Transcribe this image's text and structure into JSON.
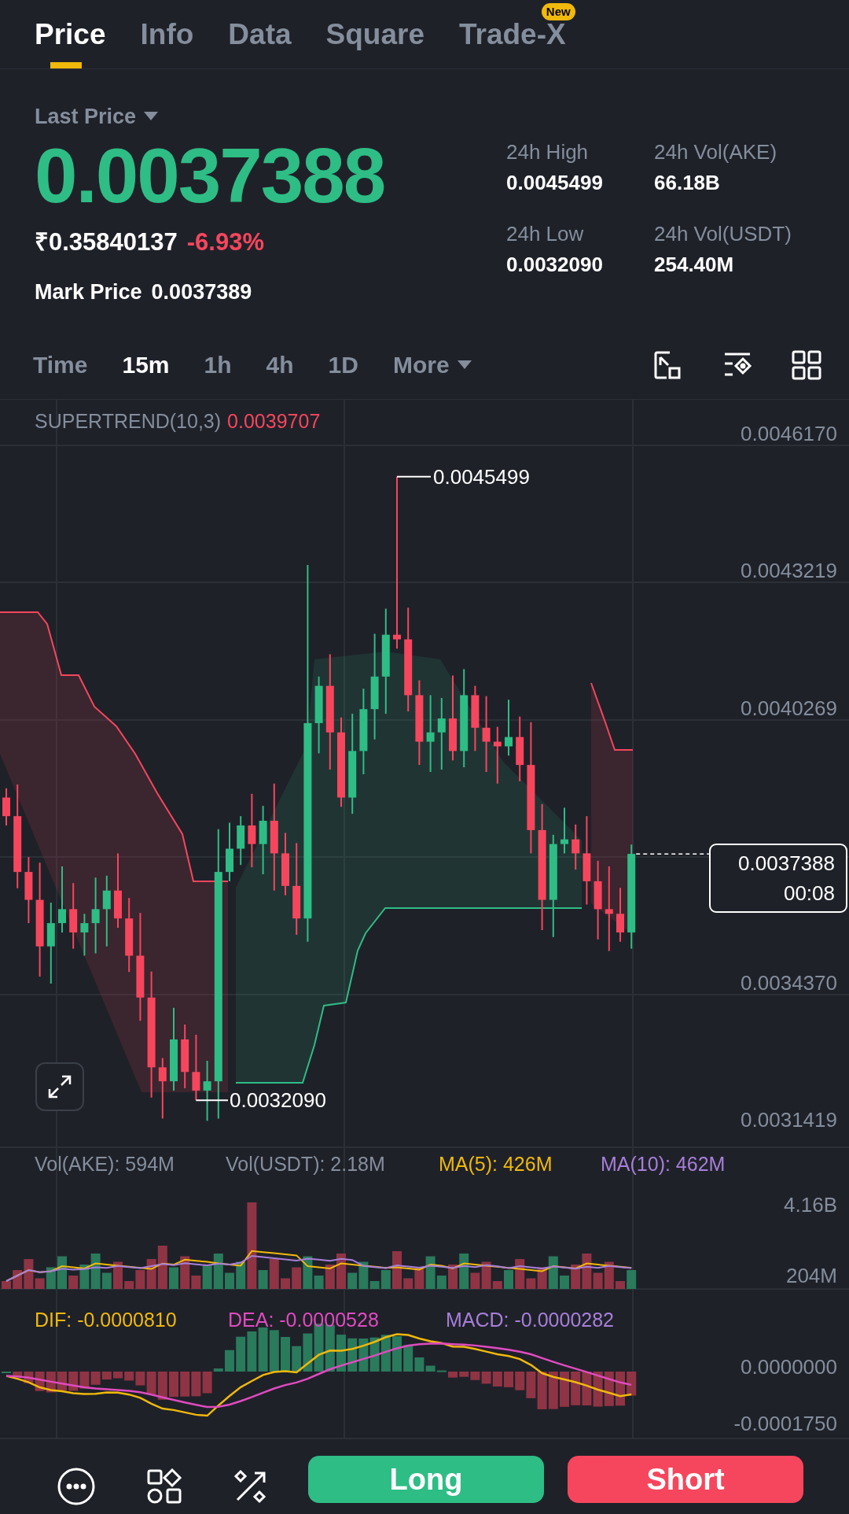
{
  "tabs": [
    {
      "label": "Price",
      "selected": true
    },
    {
      "label": "Info",
      "selected": false
    },
    {
      "label": "Data",
      "selected": false
    },
    {
      "label": "Square",
      "selected": false
    },
    {
      "label": "Trade-X",
      "selected": false,
      "badge": "New"
    }
  ],
  "price": {
    "selector": "Last Price",
    "last": "0.0037388",
    "fiat": "₹0.35840137",
    "change": "-6.93%",
    "mark_label": "Mark Price",
    "mark_value": "0.0037389"
  },
  "stats": [
    {
      "label": "24h High",
      "value": "0.0045499"
    },
    {
      "label": "24h Vol(AKE)",
      "value": "66.18B"
    },
    {
      "label": "24h Low",
      "value": "0.0032090"
    },
    {
      "label": "24h Vol(USDT)",
      "value": "254.40M"
    }
  ],
  "intervals": [
    {
      "label": "Time",
      "selected": false
    },
    {
      "label": "15m",
      "selected": true
    },
    {
      "label": "1h",
      "selected": false
    },
    {
      "label": "4h",
      "selected": false
    },
    {
      "label": "1D",
      "selected": false
    },
    {
      "label": "More",
      "selected": false,
      "dropdown": true
    }
  ],
  "chart": {
    "indicator": "SUPERTREND(10,3)",
    "indicator_value": "0.0039707",
    "y_labels": [
      "0.0046170",
      "0.0043219",
      "0.0040269",
      "0.0034370",
      "0.0031419"
    ],
    "high_marker": "0.0045499",
    "low_marker": "0.0032090",
    "current_price": "0.0037388",
    "countdown": "00:08"
  },
  "volume": {
    "legend": [
      {
        "text": "Vol(AKE): 594M",
        "color": "#848e9c"
      },
      {
        "text": "Vol(USDT): 2.18M",
        "color": "#848e9c"
      },
      {
        "text": "MA(5): 426M",
        "color": "#f0b90b"
      },
      {
        "text": "MA(10): 462M",
        "color": "#a77fd9"
      }
    ],
    "y_labels": [
      "4.16B",
      "204M"
    ]
  },
  "macd": {
    "legend": [
      {
        "text": "DIF: -0.0000810",
        "color": "#f0b90b"
      },
      {
        "text": "DEA: -0.0000528",
        "color": "#e04bc0"
      },
      {
        "text": "MACD: -0.0000282",
        "color": "#a77fd9"
      }
    ],
    "y_labels": [
      "0.0000000",
      "-0.0001750"
    ]
  },
  "actions": [
    {
      "label": "Long",
      "kind": "buy"
    },
    {
      "label": "Short",
      "kind": "sell"
    }
  ]
}
